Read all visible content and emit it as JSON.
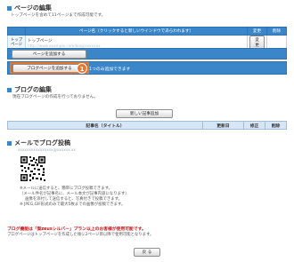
{
  "page_section": {
    "title": "ページの編集",
    "subtitle": "トップページを含めて11ページまで作成可能です。",
    "table_headers": [
      "ページ名（クリックすると新しいウインドウであらわれます）",
      "変更",
      "削除"
    ],
    "rows": [
      {
        "name": "トップページ",
        "title": "トップページ",
        "url": "http://www.example.com/blog/xxxxxxx",
        "edit": "変更",
        "delete": ""
      }
    ],
    "add_page_button": "ページを追加する",
    "add_blog_page_button": "ブログページを追加する",
    "blog_page_note": "1つのみ追加できます",
    "callout_number": "1"
  },
  "blog_section": {
    "title": "ブログの編集",
    "subtitle": "現在ブログページの作成を行っておりません。",
    "new_post_button": "新しい記事追加",
    "headers": [
      "記事名（タイトル）",
      "更新日",
      "修正",
      "削除"
    ]
  },
  "mail_section": {
    "title": "メールでブログ投稿",
    "address": "xxxxxxxxxxxxxxxx@xxxxxx.xx",
    "notes": [
      "※メールに送信すると、簡単にブログ投稿できます。",
      "（メール件名が記事名に、メール本文が記事内容になります）",
      "画像を添付して送信すると、写真付きで投稿できます。",
      "※ JPEG,GIF形式のみで最大5枚までの画像が投稿できます。"
    ]
  },
  "footer": {
    "warning": "ブログ機能は「案zeusシルバー」プラン以上のお客様が使用可能です。",
    "note": "ブログページはトップページを作成した後に2ページ目以降で使用可能となります。",
    "back_button": "戻 る"
  }
}
